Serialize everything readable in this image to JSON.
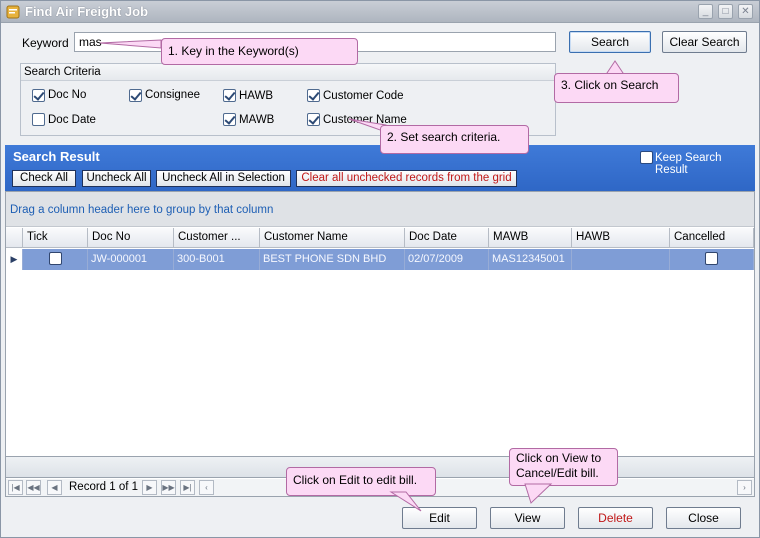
{
  "window": {
    "title": "Find Air Freight Job",
    "controls": [
      "_",
      "□",
      "✕"
    ]
  },
  "keyword": {
    "label": "Keyword",
    "value": "mas"
  },
  "buttons": {
    "search": "Search",
    "clear_search": "Clear Search"
  },
  "criteria": {
    "title": "Search Criteria",
    "items": [
      {
        "label": "Doc No",
        "checked": true
      },
      {
        "label": "Consignee",
        "checked": true
      },
      {
        "label": "HAWB",
        "checked": true
      },
      {
        "label": "Customer Code",
        "checked": true
      },
      {
        "label": "Doc Date",
        "checked": false
      },
      {
        "label": "MAWB",
        "checked": true
      },
      {
        "label": "Customer Name",
        "checked": true
      }
    ]
  },
  "result": {
    "title": "Search Result",
    "keep_label": "Keep Search Result",
    "check_all": "Check All",
    "uncheck_all": "Uncheck All",
    "uncheck_selection": "Uncheck All in Selection",
    "clear_unchecked": "Clear all unchecked records from the grid"
  },
  "grid": {
    "group_hint": "Drag a column header here to group by that column",
    "columns": [
      "Tick",
      "Doc No",
      "Customer ...",
      "Customer Name",
      "Doc Date",
      "MAWB",
      "HAWB",
      "Cancelled"
    ],
    "rows": [
      {
        "tick": false,
        "doc_no": "JW-000001",
        "customer_code": "300-B001",
        "customer_name": "BEST PHONE SDN BHD",
        "doc_date": "02/07/2009",
        "mawb": "MAS12345001",
        "hawb": "",
        "cancelled": false
      }
    ],
    "record_text": "Record 1 of 1"
  },
  "actions": {
    "edit": "Edit",
    "view": "View",
    "delete": "Delete",
    "close": "Close"
  },
  "callouts": {
    "keyword": "1. Key in the Keyword(s)",
    "criteria": "2. Set search criteria.",
    "search": "3. Click on Search",
    "edit": "Click on Edit to edit bill.",
    "view_line1": "Click on View to",
    "view_line2": "Cancel/Edit bill."
  },
  "colors": {
    "result_bar": "#3f7ad8",
    "selected_row": "#7f9dd6",
    "callout": "#fcd9f5",
    "delete_text": "#c01818"
  }
}
